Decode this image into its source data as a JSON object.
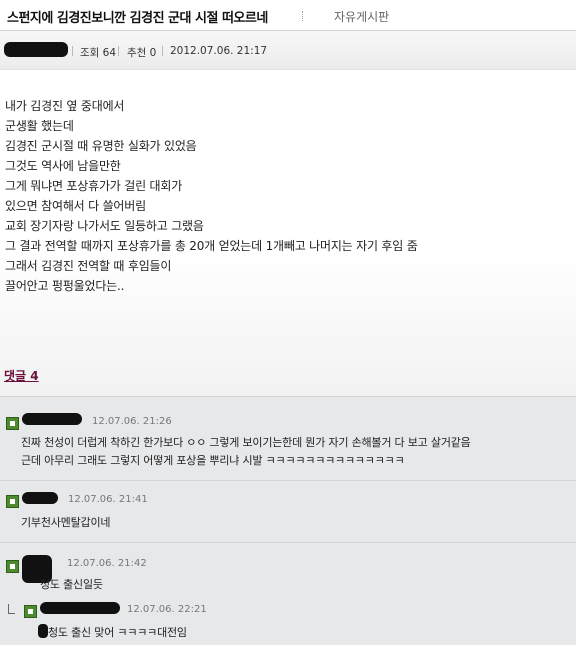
{
  "header": {
    "title": "스펀지에 김경진보니깐 김경진 군대 시절 떠오르네",
    "board": "자유게시판"
  },
  "meta": {
    "views": "조회 64",
    "recommend": "추천 0",
    "datetime": "2012.07.06. 21:17"
  },
  "body_lines": [
    "내가 김경진 옆 중대에서",
    "군생활 했는데",
    "김경진 군시절 때 유명한 실화가 있었음",
    "그것도 역사에 남을만한",
    "그게 뭐냐면 포상휴가가 걸린 대회가",
    "있으면 참여해서 다 쓸어버림",
    "교회 장기자랑 나가서도 일등하고 그랬음",
    "그 결과 전역할 때까지 포상휴가를 총 20개 얻었는데 1개빼고 나머지는 자기 후임 줌",
    "그래서 김경진 전역할 때 후임들이",
    "끌어안고 펑펑울었다는.."
  ],
  "comments_toggle": "댓글 4",
  "comments": [
    {
      "date": "12.07.06. 21:26",
      "lines": [
        "진짜 천성이 더럽게 착하긴 한가보다 ㅇㅇ 그렇게 보이기는한데 뭔가 자기 손해볼거 다 보고 살거같음",
        "근데 아무리 그래도 그렇지 어떻게 포상을 뿌리냐 시발 ㅋㅋㅋㅋㅋㅋㅋㅋㅋㅋㅋㅋㅋㅋ"
      ]
    },
    {
      "date": "12.07.06. 21:41",
      "lines": [
        "기부천사멘탈갑이네"
      ]
    },
    {
      "date": "12.07.06. 21:42",
      "lines": [
        "청도 출신일듯"
      ]
    },
    {
      "date": "12.07.06. 22:21",
      "lines": [
        "청도 출신 맞어 ㅋㅋㅋㅋ대전임"
      ]
    }
  ],
  "colors": {
    "accent_link": "#6b0e3c",
    "comment_bg": "#e7e8ea",
    "comment_icon": "#4e8b2e"
  }
}
